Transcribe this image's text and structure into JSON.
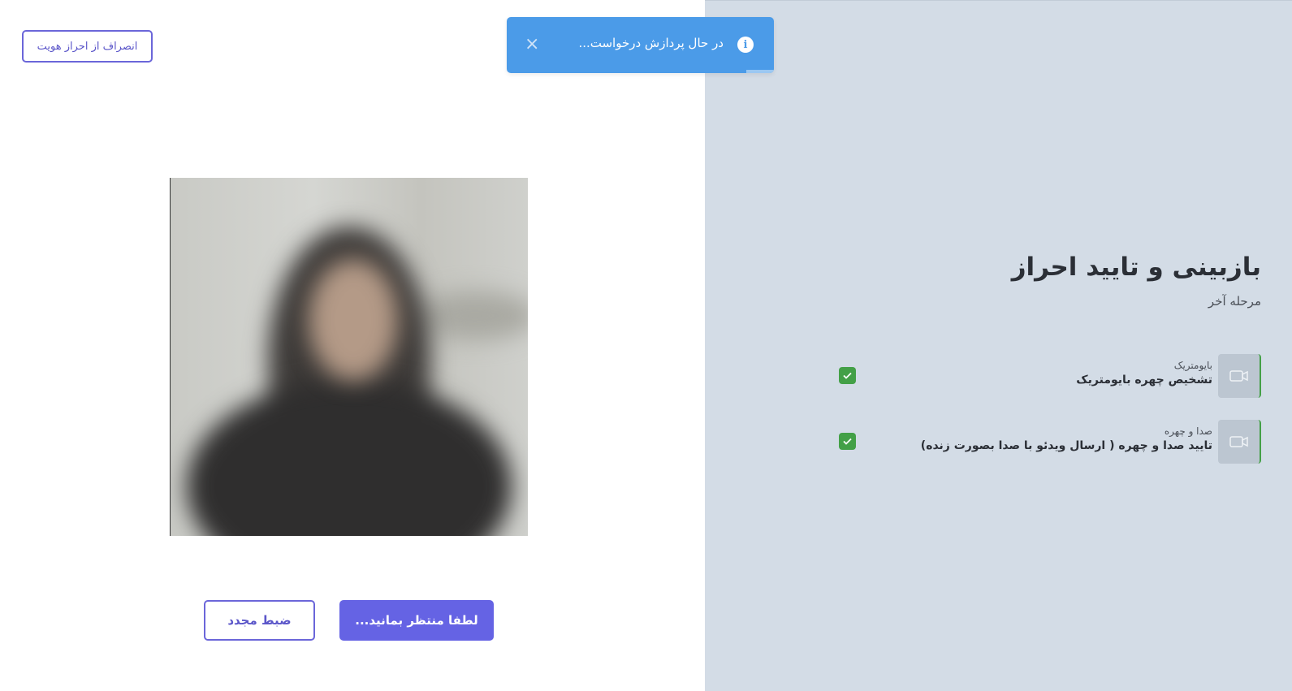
{
  "left": {
    "cancel_label": "انصراف از احراز هویت",
    "wait_label": "لطفا منتظر بمانید...",
    "rerecord_label": "ضبط مجدد"
  },
  "toast": {
    "message": "در حال پردازش درخواست...",
    "info_icon": "i",
    "close_icon": "×",
    "color": "#4b9be8"
  },
  "right": {
    "title": "بازبینی و تایید احراز",
    "subtitle": "مرحله آخر",
    "steps": [
      {
        "category": "بایومتریک",
        "name": "تشخیص چهره بایومتریک",
        "icon": "video-camera-icon",
        "status": "done"
      },
      {
        "category": "صدا و چهره",
        "name": "تایید صدا و چهره ( ارسال ویدئو با صدا بصورت زنده)",
        "icon": "video-camera-icon",
        "status": "done"
      }
    ]
  },
  "colors": {
    "accent": "#6563e4",
    "right_panel_bg": "#d3dce6",
    "check_green": "#43a047"
  }
}
